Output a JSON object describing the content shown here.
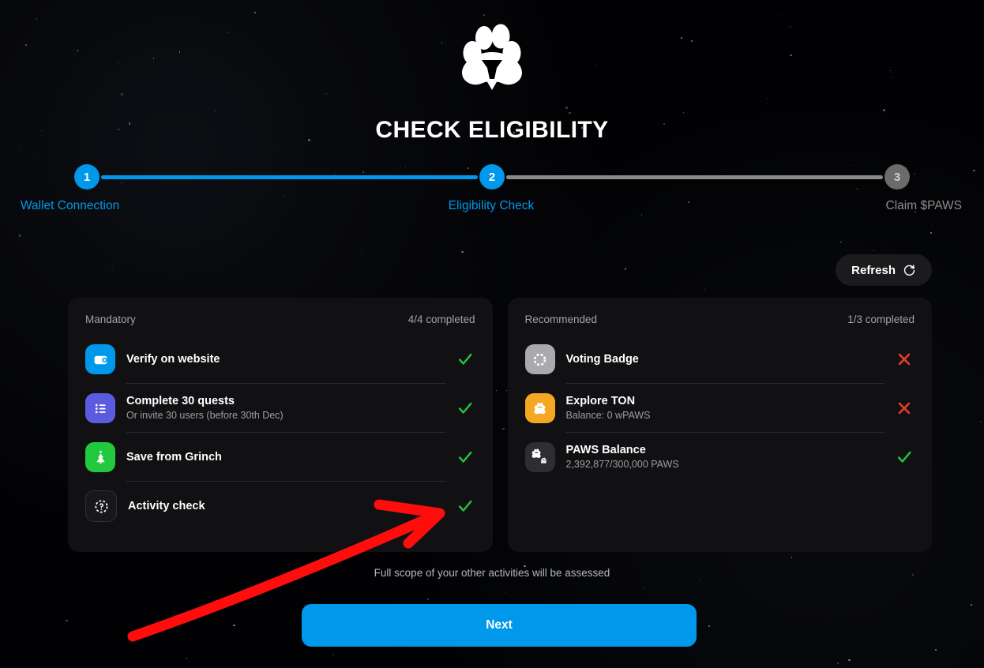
{
  "app": {
    "logo_icon": "paw-logo-icon",
    "title": "CHECK ELIGIBILITY"
  },
  "stepper": {
    "steps": [
      {
        "number": "1",
        "label": "Wallet Connection",
        "state": "active"
      },
      {
        "number": "2",
        "label": "Eligibility Check",
        "state": "active"
      },
      {
        "number": "3",
        "label": "Claim $PAWS",
        "state": "inactive"
      }
    ],
    "colors": {
      "active": "#0098EA",
      "inactive": "#8a8a8a"
    }
  },
  "toolbar": {
    "refresh_label": "Refresh",
    "refresh_icon": "refresh-icon"
  },
  "cards": {
    "mandatory": {
      "heading": "Mandatory",
      "progress": "4/4 completed",
      "tasks": [
        {
          "title": "Verify on website",
          "subtitle": "",
          "icon": "wallet-icon",
          "icon_color": "#0098EA",
          "status": "check"
        },
        {
          "title": "Complete 30 quests",
          "subtitle": "Or invite 30 users (before 30th Dec)",
          "icon": "list-icon",
          "icon_color": "#5B5BE0",
          "status": "check"
        },
        {
          "title": "Save from Grinch",
          "subtitle": "",
          "icon": "christmas-tree-icon",
          "icon_color": "#22C93F",
          "status": "check"
        },
        {
          "title": "Activity check",
          "subtitle": "",
          "icon": "question-badge-icon",
          "icon_color": "#18181b",
          "status": "check"
        }
      ]
    },
    "recommended": {
      "heading": "Recommended",
      "progress": "1/3 completed",
      "tasks": [
        {
          "title": "Voting Badge",
          "subtitle": "",
          "icon": "dashed-circle-icon",
          "icon_color": "#A9A9AE",
          "status": "cross"
        },
        {
          "title": "Explore TON",
          "subtitle": "Balance: 0 wPAWS",
          "icon": "paw-icon",
          "icon_color": "#F5A623",
          "status": "cross"
        },
        {
          "title": "PAWS Balance",
          "subtitle": "2,392,877/300,000 PAWS",
          "icon": "paws-stack-icon",
          "icon_color": "#2e2e32",
          "status": "check"
        }
      ]
    }
  },
  "footer": {
    "note": "Full scope of your other activities will be assessed",
    "next_label": "Next"
  },
  "annotation": {
    "type": "red-arrow",
    "color": "#FF0D0D",
    "points_to": "activity-check-status"
  },
  "theme": {
    "background": "#010103",
    "card_background": "#111113",
    "accent": "#0098EA",
    "success": "#22C93F",
    "error": "#E8392E",
    "muted_text": "#9d9da2"
  }
}
